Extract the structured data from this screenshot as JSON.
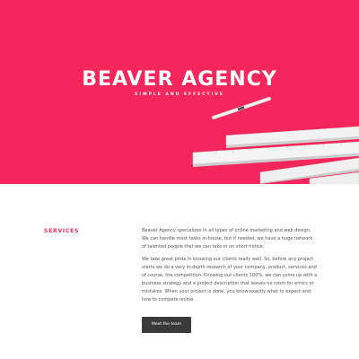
{
  "hero": {
    "title": "BEAVER AGENCY",
    "subtitle": "SIMPLE AND EFFECTIVE",
    "background_color": "#f4265c"
  },
  "services": {
    "label": "SERVICES",
    "paragraph_1": "Beaver Agency specializes in all types of online marketing and web design. We can handle most tasks in-house, but if needed, we have a huge network of talented people that we can take in on short notice.",
    "paragraph_2": "We take great pride in knowing our clients really well. So, before any project starts we do a very in-depth research of your company, product, services and of course, the competition. Knowing our clients 100%, we can come up with a business strategy and a project description that leaves no room for errors or mistakes. When your project is done, you know exactly what to expect and how to compete online.",
    "cta_label": "Meet the team"
  },
  "colors": {
    "accent": "#f4265c",
    "button": "#3a3a3a"
  }
}
